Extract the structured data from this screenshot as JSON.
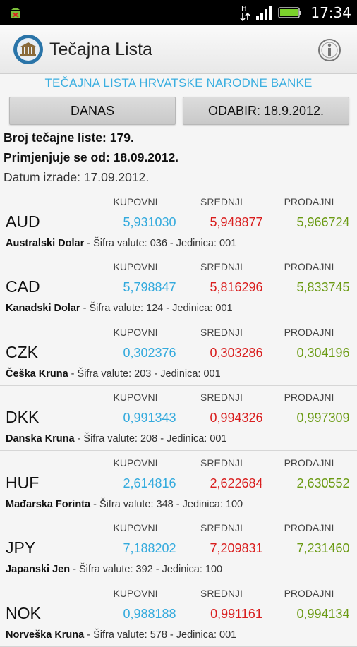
{
  "status": {
    "time": "17:34",
    "net": "H"
  },
  "app": {
    "title": "Tečajna Lista"
  },
  "banner": "TEČAJNA LISTA HRVATSKE NARODNE BANKE",
  "buttons": {
    "danas": "DANAS",
    "odabir": "ODABIR: 18.9.2012."
  },
  "meta": {
    "broj": "Broj tečajne liste: 179.",
    "primjenjuje": "Primjenjuje se od: 18.09.2012.",
    "datum": "Datum izrade: 17.09.2012."
  },
  "columns": {
    "kupovni": "KUPOVNI",
    "srednji": "SREDNJI",
    "prodajni": "PRODAJNI"
  },
  "currencies": [
    {
      "code": "AUD",
      "kupovni": "5,931030",
      "srednji": "5,948877",
      "prodajni": "5,966724",
      "name": "Australski Dolar",
      "info": " - Šifra valute: 036 - Jedinica: 001"
    },
    {
      "code": "CAD",
      "kupovni": "5,798847",
      "srednji": "5,816296",
      "prodajni": "5,833745",
      "name": "Kanadski Dolar",
      "info": " - Šifra valute: 124 - Jedinica: 001"
    },
    {
      "code": "CZK",
      "kupovni": "0,302376",
      "srednji": "0,303286",
      "prodajni": "0,304196",
      "name": "Češka Kruna",
      "info": " - Šifra valute: 203 - Jedinica: 001"
    },
    {
      "code": "DKK",
      "kupovni": "0,991343",
      "srednji": "0,994326",
      "prodajni": "0,997309",
      "name": "Danska Kruna",
      "info": " - Šifra valute: 208 - Jedinica: 001"
    },
    {
      "code": "HUF",
      "kupovni": "2,614816",
      "srednji": "2,622684",
      "prodajni": "2,630552",
      "name": "Mađarska Forinta",
      "info": " - Šifra valute: 348 - Jedinica: 100"
    },
    {
      "code": "JPY",
      "kupovni": "7,188202",
      "srednji": "7,209831",
      "prodajni": "7,231460",
      "name": "Japanski Jen",
      "info": " - Šifra valute: 392 - Jedinica: 100"
    },
    {
      "code": "NOK",
      "kupovni": "0,988188",
      "srednji": "0,991161",
      "prodajni": "0,994134",
      "name": "Norveška Kruna",
      "info": " - Šifra valute: 578 - Jedinica: 001"
    }
  ],
  "colors": {
    "kupovni": "#33aadd",
    "srednji": "#d91e1e",
    "prodajni": "#6a9a12",
    "banner": "#3aaee0"
  },
  "icons": {
    "app": "bank-logo-icon",
    "info": "info-icon",
    "notification": "android-notification-icon"
  }
}
